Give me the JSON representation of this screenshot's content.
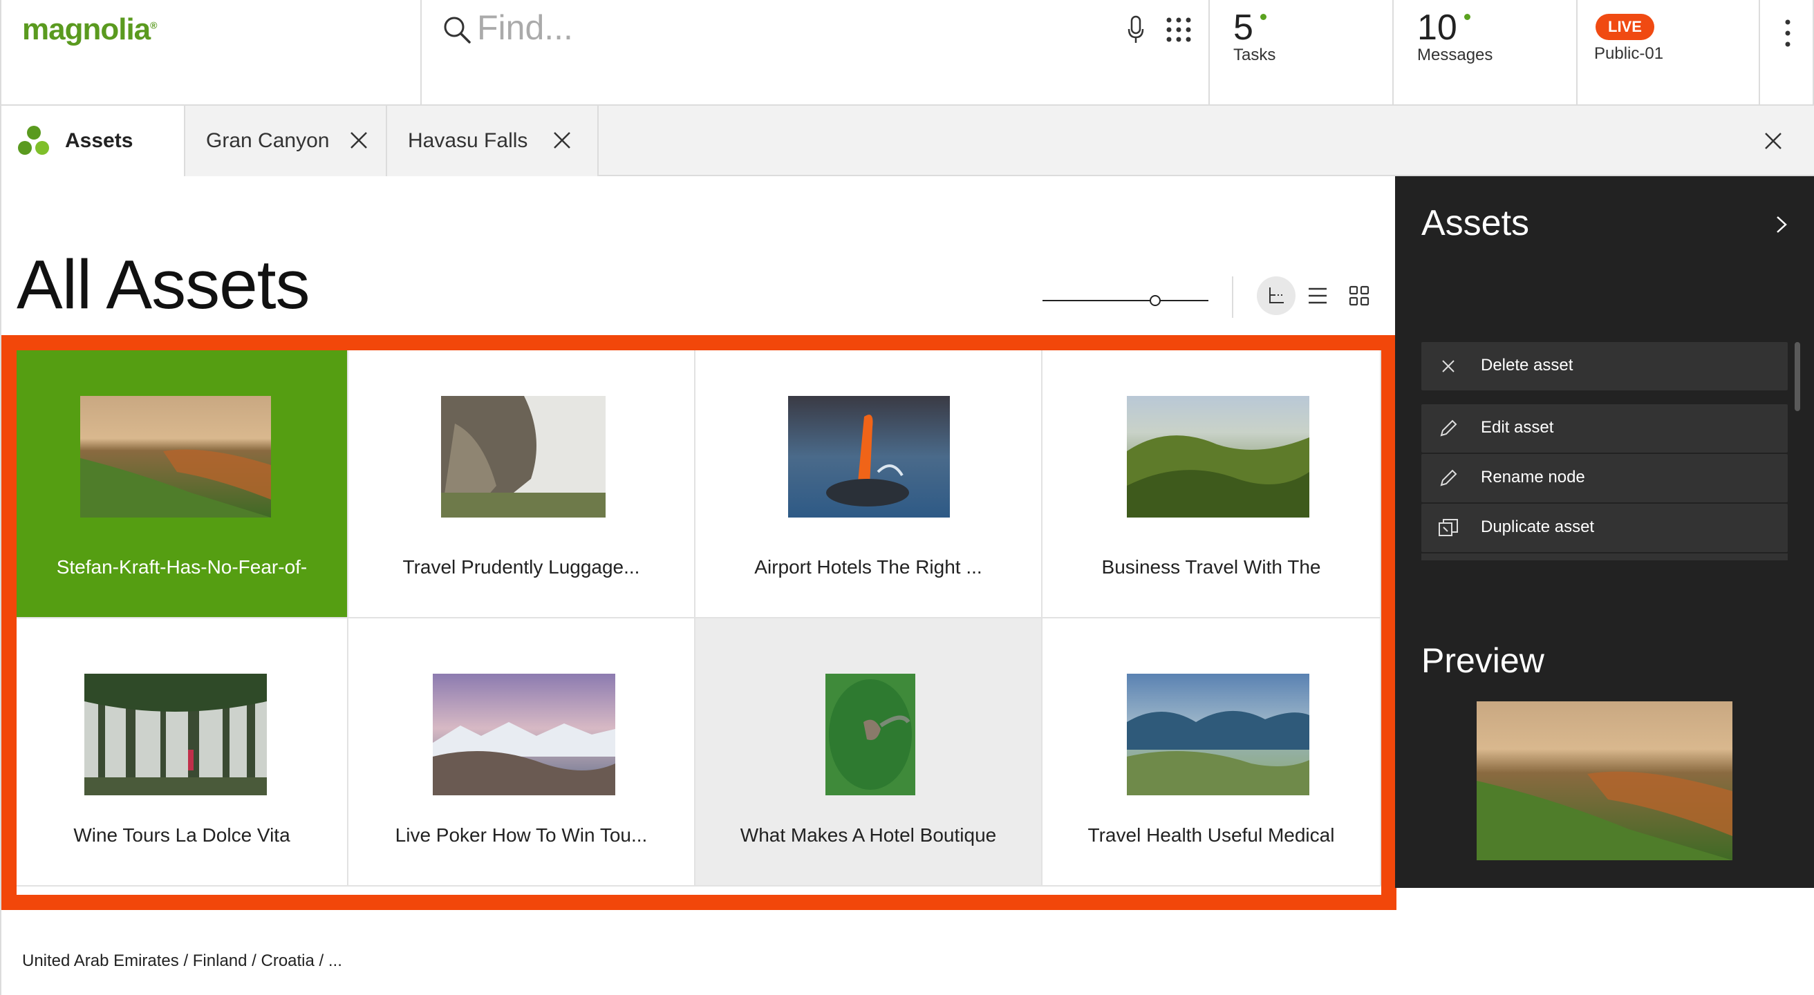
{
  "app": {
    "logo": "magnolia"
  },
  "search": {
    "placeholder": "Find..."
  },
  "stats": [
    {
      "value": "5",
      "label": "Tasks"
    },
    {
      "value": "10",
      "label": "Messages"
    }
  ],
  "environment": {
    "badge": "LIVE",
    "name": "Public-01"
  },
  "tabs": [
    {
      "label": "Assets"
    },
    {
      "label": "Gran Canyon"
    },
    {
      "label": "Havasu Falls"
    }
  ],
  "page": {
    "title": "All Assets",
    "zoom_level": 0.68
  },
  "assets": [
    {
      "label": "Stefan-Kraft-Has-No-Fear-of-",
      "state": "selected"
    },
    {
      "label": "Travel Prudently Luggage..."
    },
    {
      "label": "Airport Hotels The Right ..."
    },
    {
      "label": "Business Travel With The"
    },
    {
      "label": "Wine Tours La Dolce Vita"
    },
    {
      "label": "Live Poker How To Win Tou..."
    },
    {
      "label": "What Makes A Hotel Boutique",
      "state": "hover"
    },
    {
      "label": "Travel Health Useful Medical"
    }
  ],
  "footer": {
    "path": "United Arab Emirates / Finland / Croatia / ..."
  },
  "panel": {
    "title": "Assets",
    "actions": [
      {
        "label": "Delete asset",
        "icon": "close-icon"
      },
      {
        "label": "Edit asset",
        "icon": "pencil-icon"
      },
      {
        "label": "Rename node",
        "icon": "pencil-icon"
      },
      {
        "label": "Duplicate asset",
        "icon": "duplicate-icon"
      }
    ],
    "preview_title": "Preview"
  },
  "colors": {
    "brand": "#5a9a1f",
    "accent": "#f2470a",
    "selected": "#559e12",
    "panel_bg": "#222222"
  }
}
